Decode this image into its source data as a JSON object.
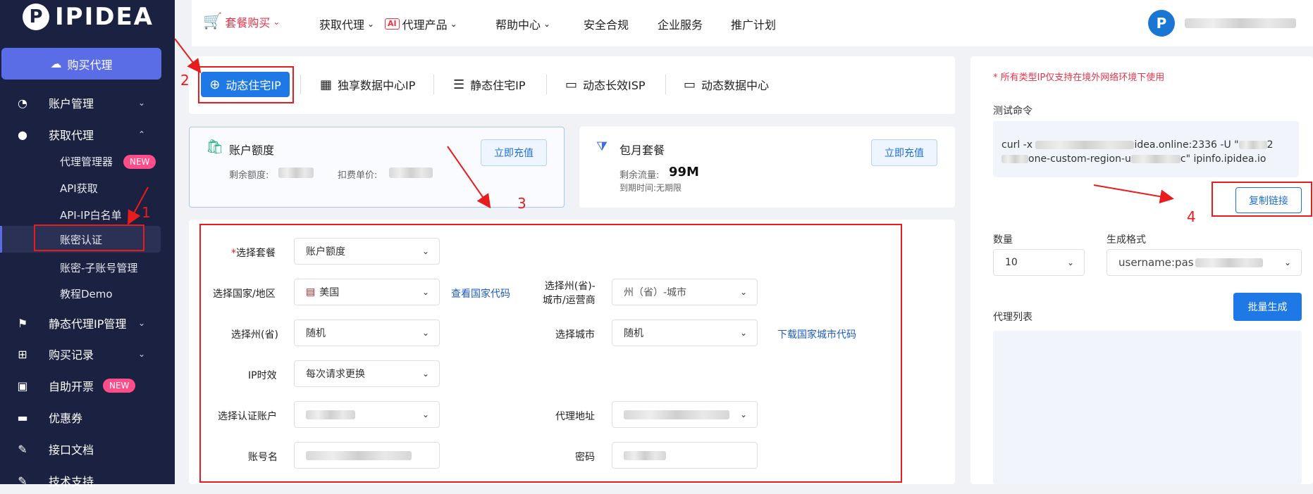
{
  "sidebar": {
    "logo_text": "IPIDEA",
    "buy_button": "购买代理",
    "items": [
      {
        "label": "账户管理",
        "icon": "pie-chart-icon"
      },
      {
        "label": "获取代理",
        "icon": "user-icon"
      },
      {
        "label": "静态代理IP管理",
        "icon": "flag-icon"
      },
      {
        "label": "购买记录",
        "icon": "basket-icon"
      },
      {
        "label": "自助开票",
        "icon": "invoice-icon"
      },
      {
        "label": "优惠券",
        "icon": "coupon-icon"
      },
      {
        "label": "接口文档",
        "icon": "edit-doc-icon"
      },
      {
        "label": "技术支持",
        "icon": "edit-icon"
      }
    ],
    "subitems": [
      "代理管理器",
      "API获取",
      "API-IP白名单",
      "账密认证",
      "账密-子账号管理",
      "教程Demo"
    ],
    "new_badge": "NEW"
  },
  "topnav": {
    "items": [
      "套餐购买",
      "获取代理",
      "代理产品",
      "帮助中心",
      "安全合规",
      "企业服务",
      "推广计划"
    ],
    "ai_tag": "AI"
  },
  "tabs": [
    "动态住宅IP",
    "独享数据中心IP",
    "静态住宅IP",
    "动态长效ISP",
    "动态数据中心"
  ],
  "account_card": {
    "title": "账户额度",
    "remaining_label": "剩余额度:",
    "price_label": "扣费单价:",
    "recharge": "立即充值"
  },
  "monthly_card": {
    "title": "包月套餐",
    "traffic_label": "剩余流量:",
    "traffic_value": "99M",
    "expiry": "到期时间:无期限",
    "recharge": "立即充值"
  },
  "form": {
    "package_label": "选择套餐",
    "package_value": "账户额度",
    "country_label": "选择国家/地区",
    "country_value": "美国",
    "country_link": "查看国家代码",
    "state_city_label_1": "选择州(省)-",
    "state_city_label_2": "城市/运营商",
    "state_city_value": "州（省）-城市",
    "state_label": "选择州(省)",
    "state_value": "随机",
    "city_label": "选择城市",
    "city_value": "随机",
    "city_link": "下载国家城市代码",
    "ip_label": "IP时效",
    "ip_value": "每次请求更换",
    "auth_label": "选择认证账户",
    "proxy_addr_label": "代理地址",
    "username_label": "账号名",
    "password_label": "密码"
  },
  "right": {
    "notice": "* 所有类型IP仅支持在境外网络环境下使用",
    "test_cmd_label": "测试命令",
    "cmd_line1_a": "curl -x",
    "cmd_line1_b": "idea.online:2336 -U \"",
    "cmd_line1_c": "2",
    "cmd_line2_b": "one-custom-region-u",
    "cmd_line2_c": "c\" ipinfo.ipidea.io",
    "copy_btn": "复制链接",
    "qty_label": "数量",
    "qty_value": "10",
    "format_label": "生成格式",
    "format_value": "username:pas",
    "gen_btn": "批量生成",
    "list_label": "代理列表"
  },
  "annotations": [
    "1",
    "2",
    "3",
    "4"
  ],
  "colors": {
    "sidebar_bg": "#1b2140",
    "primary": "#1e78e6",
    "annotation_red": "#e81c1c",
    "new_badge": "#ff4d8a"
  }
}
